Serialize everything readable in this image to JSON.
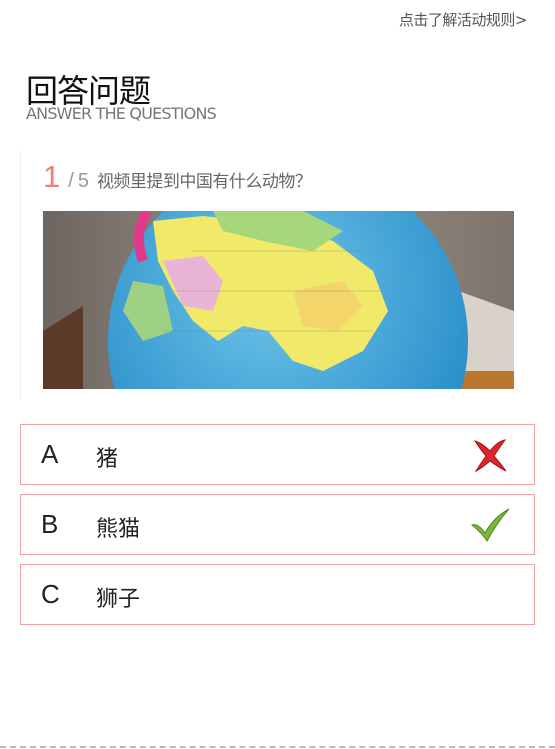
{
  "header": {
    "rules_link": "点击了解活动规则>"
  },
  "page": {
    "title": "回答问题",
    "subtitle": "ANSWER THE QUESTIONS"
  },
  "question": {
    "number": "1",
    "separator": "/",
    "total": "5",
    "text": "视频里提到中国有什么动物？"
  },
  "options": [
    {
      "letter": "A",
      "text": "猪",
      "status": "wrong",
      "icon": "cross-icon"
    },
    {
      "letter": "B",
      "text": "熊猫",
      "status": "correct",
      "icon": "check-icon"
    },
    {
      "letter": "C",
      "text": "狮子",
      "status": "none",
      "icon": ""
    }
  ],
  "colors": {
    "accent": "#f47c73",
    "option_border": "#f0a3a3",
    "wrong": "#e0242a",
    "correct": "#7ab837"
  }
}
